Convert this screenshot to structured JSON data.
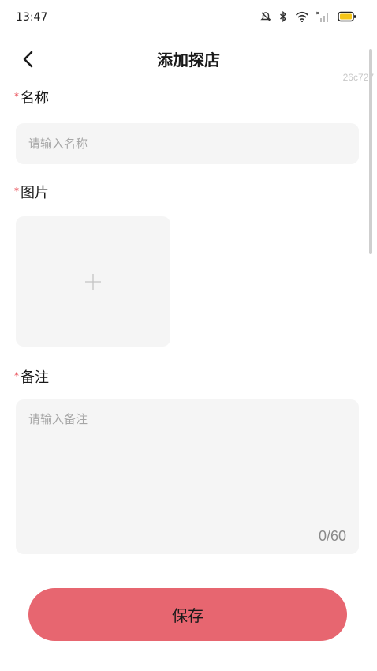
{
  "status_bar": {
    "time": "13:47",
    "icons": [
      "alarm-icon",
      "bluetooth-icon",
      "wifi-icon",
      "signal-icon",
      "battery-icon"
    ],
    "battery_color": "#f5c518"
  },
  "nav": {
    "back_icon": "chevron-left-icon",
    "title": "添加探店"
  },
  "debug_tag": "26c727",
  "form": {
    "required_mark": "*",
    "name": {
      "label": "名称",
      "placeholder": "请输入名称",
      "value": ""
    },
    "image": {
      "label": "图片",
      "upload_icon": "plus-icon"
    },
    "remark": {
      "label": "备注",
      "placeholder": "请输入备注",
      "value": "",
      "counter": "0/60"
    }
  },
  "save_button": {
    "label": "保存",
    "color": "#e76670"
  },
  "colors": {
    "required": "#e8454f",
    "field_bg": "#f5f5f5",
    "placeholder": "#a6a6a6"
  }
}
